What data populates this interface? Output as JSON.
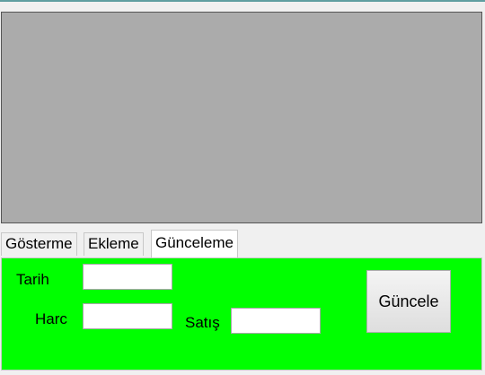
{
  "grid": {},
  "tabs": [
    {
      "label": "Gösterme"
    },
    {
      "label": "Ekleme"
    },
    {
      "label": "Günceleme"
    }
  ],
  "active_tab": "Günceleme",
  "form": {
    "tarih_label": "Tarih",
    "tarih_value": "",
    "harc_label": "Harc",
    "harc_value": "",
    "satis_label": "Satış",
    "satis_value": "",
    "update_button": "Güncele"
  },
  "colors": {
    "panel_bg": "#00ff00",
    "grid_bg": "#ababab"
  }
}
